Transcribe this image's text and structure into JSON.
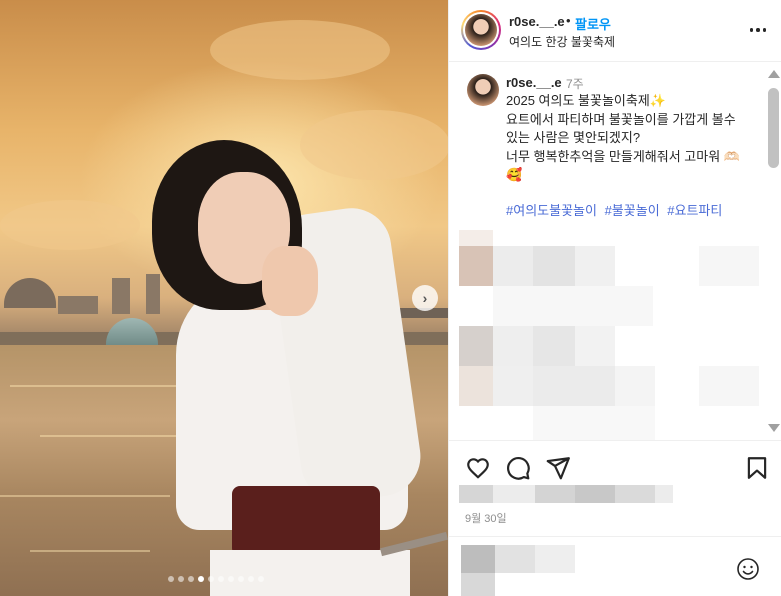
{
  "post": {
    "username": "r0se.__.e",
    "follow_label": "팔로우",
    "separator": "•",
    "location": "여의도 한강 불꽃축제"
  },
  "caption": {
    "username": "r0se.__.e",
    "time": "7주",
    "text": "2025 여의도 불꽃놀이축제✨\n요트에서 파티하며 불꽃놀이를 가깝게 볼수있는 사람은 몇안되겠지?\n너무 행복한추억을 만들게해줘서 고마워 🫶🏻 🥰",
    "hashtags": [
      "#여의도불꽃놀이",
      "#불꽃놀이",
      "#요트파티"
    ]
  },
  "meta": {
    "date": "9월 30일"
  },
  "carousel": {
    "next_icon": "chevron-right-icon",
    "next_glyph": "›",
    "total_slides": 10,
    "active_index": 3
  },
  "icons": {
    "more": "more-horizontal-icon",
    "like": "heart-icon",
    "comment": "comment-icon",
    "share": "send-icon",
    "save": "bookmark-icon",
    "emoji": "smiley-icon"
  },
  "colors": {
    "follow": "#0095f6",
    "hashtag": "#4a6bd6",
    "muted": "#8e8e8e"
  }
}
